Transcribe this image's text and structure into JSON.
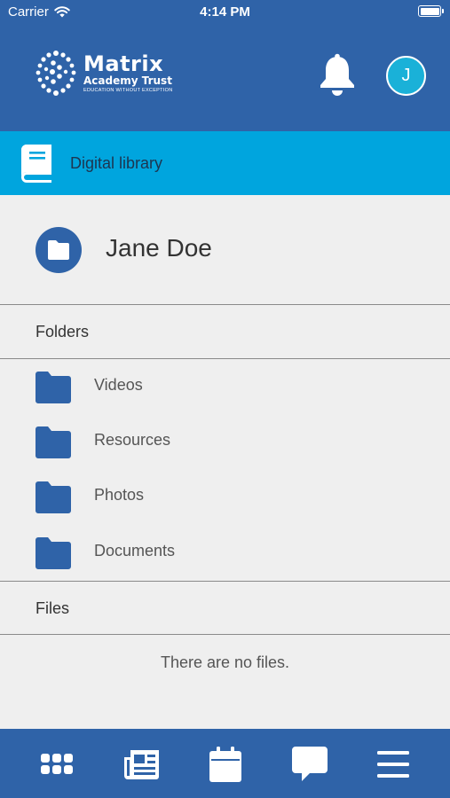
{
  "status_bar": {
    "carrier": "Carrier",
    "time": "4:14 PM"
  },
  "header": {
    "logo": {
      "line1": "Matrix",
      "line2": "Academy Trust",
      "tagline": "EDUCATION WITHOUT EXCEPTION"
    },
    "avatar_initial": "J",
    "icons": [
      "bell-icon"
    ]
  },
  "section": {
    "title": "Digital library",
    "icon": "book-icon"
  },
  "owner": {
    "name": "Jane Doe",
    "icon": "folder-icon"
  },
  "folders": {
    "heading": "Folders",
    "items": [
      {
        "label": "Videos"
      },
      {
        "label": "Resources"
      },
      {
        "label": "Photos"
      },
      {
        "label": "Documents"
      }
    ]
  },
  "files": {
    "heading": "Files",
    "empty_text": "There are no files."
  },
  "tabbar": {
    "items": [
      "dashboard-grid-icon",
      "news-icon",
      "calendar-icon",
      "messages-icon",
      "menu-icon"
    ]
  },
  "colors": {
    "primary": "#2f63a8",
    "accent": "#00a5de",
    "avatar": "#1ab1d8",
    "background": "#efefef"
  }
}
